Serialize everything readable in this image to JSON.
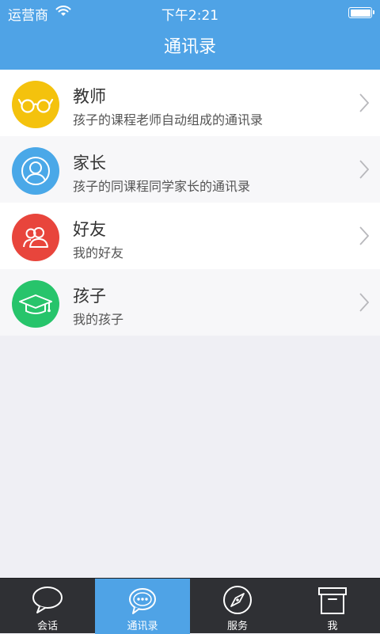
{
  "status_bar": {
    "carrier": "运营商",
    "time": "下午2:21"
  },
  "nav": {
    "title": "通讯录"
  },
  "contacts": [
    {
      "title": "教师",
      "subtitle": "孩子的课程老师自动组成的通讯录",
      "icon": "glasses-icon",
      "color": "#f4c20d"
    },
    {
      "title": "家长",
      "subtitle": "孩子的同课程同学家长的通讯录",
      "icon": "person-icon",
      "color": "#4aa8e8"
    },
    {
      "title": "好友",
      "subtitle": "我的好友",
      "icon": "friends-icon",
      "color": "#e8453c"
    },
    {
      "title": "孩子",
      "subtitle": "我的孩子",
      "icon": "graduation-cap-icon",
      "color": "#27c46b"
    }
  ],
  "tabs": [
    {
      "label": "会话",
      "icon": "chat-bubble-icon"
    },
    {
      "label": "通讯录",
      "icon": "contacts-bubble-icon",
      "active": true
    },
    {
      "label": "服务",
      "icon": "compass-icon"
    },
    {
      "label": "我",
      "icon": "archive-box-icon"
    }
  ],
  "colors": {
    "brand": "#4fa3e6",
    "tab_bar": "#2f3034",
    "background": "#efeff4"
  }
}
